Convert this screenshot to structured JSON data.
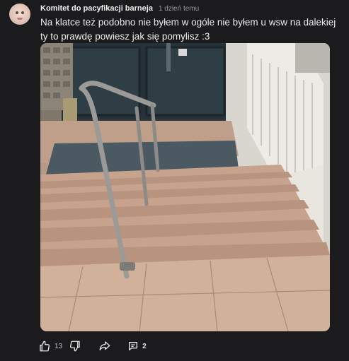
{
  "comment": {
    "author": "Komitet do pacyfikacji barneja",
    "time": "1 dzień temu",
    "text": "Na klatce  też podobno nie byłem w ogóle nie byłem u wsw na dalekiej ty to prawdę powiesz jak się pomylisz :3",
    "avatar_icon": "baby-face-avatar",
    "photo_description_icon": "stairwell-photo"
  },
  "actions": {
    "like_icon": "thumb-up-icon",
    "like_count": "13",
    "dislike_icon": "thumb-down-icon",
    "share_icon": "share-arrow-icon",
    "reply_icon": "comment-bubble-icon",
    "reply_count": "2"
  },
  "colors": {
    "background": "#1b1b1d",
    "text": "#ececec",
    "muted": "#9a9a9a"
  }
}
